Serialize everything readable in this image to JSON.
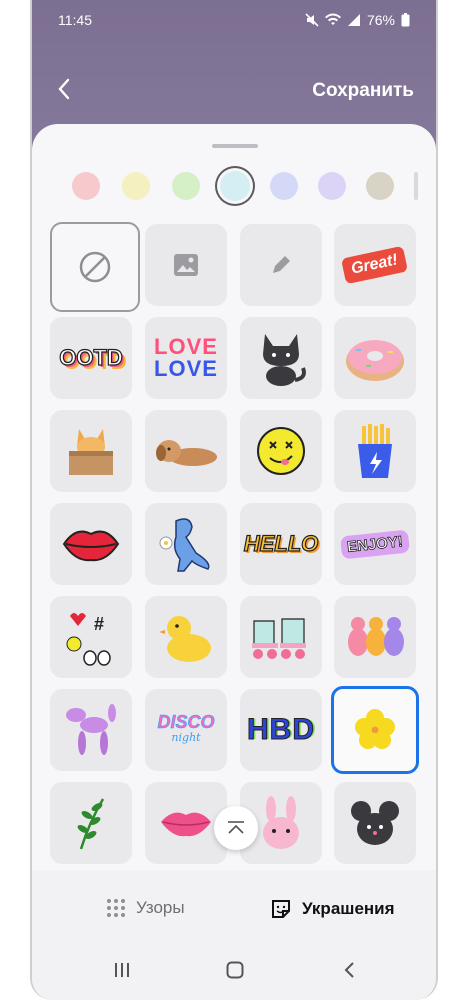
{
  "status": {
    "time": "11:45",
    "battery": "76%"
  },
  "header": {
    "save_label": "Сохранить"
  },
  "swatches": [
    "#f6c9cc",
    "#f4f0bf",
    "#d5efc6",
    "#d5eef3",
    "#d3d9f6",
    "#dcd4f6",
    "#d9d3c6"
  ],
  "stickers": {
    "ootd": "OOTD",
    "love_top": "LOVE",
    "love_bottom": "LOVE",
    "great": "Great!",
    "hello": "HELLO",
    "enjoy": "ENJOY!",
    "disco": "DISCO",
    "disco_sub": "night",
    "hbd": "HBD"
  },
  "tabs": {
    "patterns_label": "Узоры",
    "decorations_label": "Украшения"
  }
}
